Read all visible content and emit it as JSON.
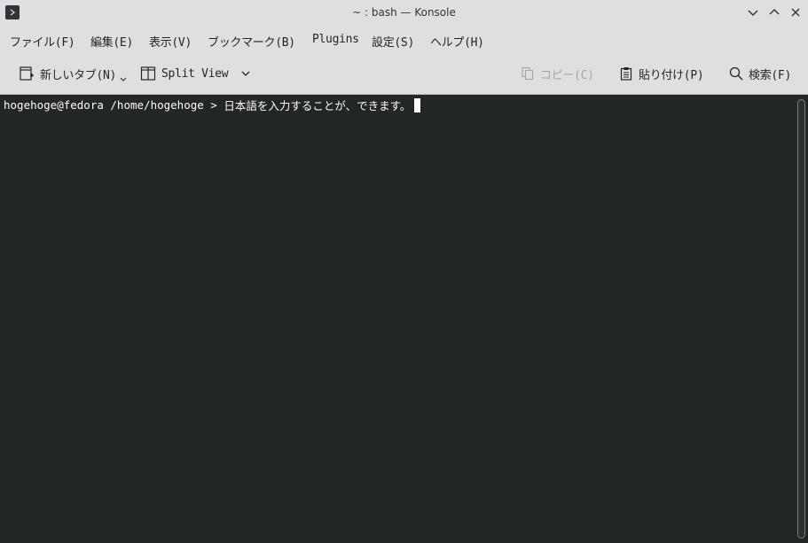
{
  "window": {
    "title": "~ : bash — Konsole",
    "app_icon": "terminal-prompt-icon"
  },
  "menubar": {
    "items": [
      {
        "label": "ファイル(F)"
      },
      {
        "label": "編集(E)"
      },
      {
        "label": "表示(V)"
      },
      {
        "label": "ブックマーク(B)"
      },
      {
        "label": "Plugins"
      },
      {
        "label": "設定(S)"
      },
      {
        "label": "ヘルプ(H)"
      }
    ]
  },
  "toolbar": {
    "new_tab_label": "新しいタブ(N)",
    "split_view_label": "Split View",
    "copy_label": "コピー(C)",
    "paste_label": "貼り付け(P)",
    "find_label": "検索(F)"
  },
  "terminal": {
    "prompt": "hogehoge@fedora /home/hogehoge > ",
    "input": "日本語を入力することが、できます。"
  },
  "colors": {
    "terminal_bg": "#232627",
    "terminal_fg": "#fcfcfc",
    "chrome_bg": "#dedfe1"
  }
}
